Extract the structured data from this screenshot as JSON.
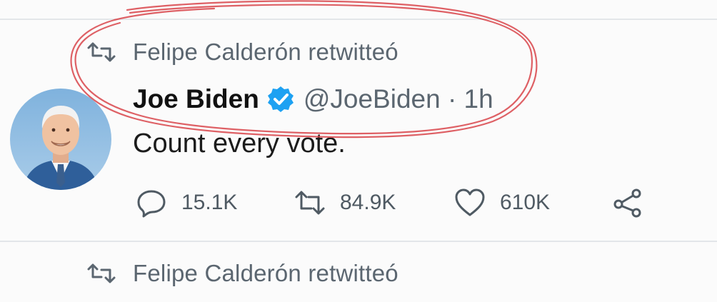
{
  "retweet_notice": {
    "text": "Felipe Calderón retwitteó"
  },
  "tweet": {
    "author_name": "Joe Biden",
    "handle_time": "@JoeBiden · 1h",
    "body": "Count every vote.",
    "actions": {
      "reply_count": "15.1K",
      "retweet_count": "84.9K",
      "like_count": "610K"
    }
  },
  "next_retweet_notice": {
    "text": "Felipe Calderón retwitteó"
  },
  "icons": {
    "retweet": "retweet-icon",
    "verified": "verified-badge-icon",
    "reply": "reply-icon",
    "like": "heart-icon",
    "share": "share-icon"
  },
  "colors": {
    "verified_blue": "#1da1f2",
    "annotation_red": "#d9464b",
    "muted_text": "#5b6670"
  }
}
